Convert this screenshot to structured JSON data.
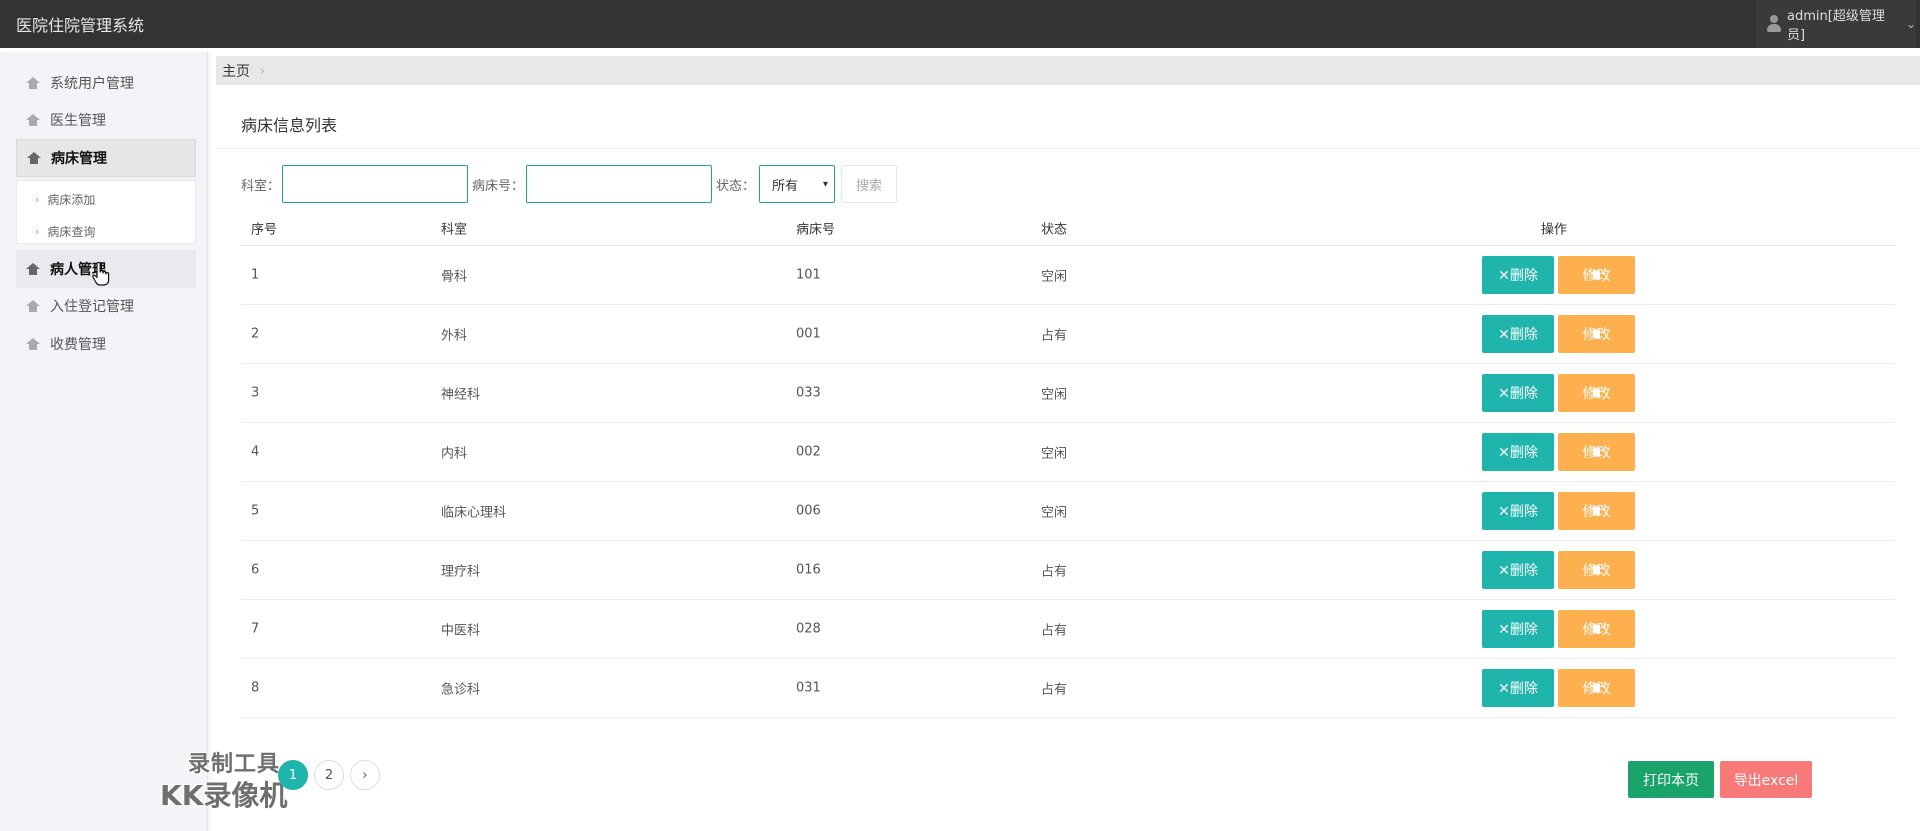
{
  "header": {
    "app_title": "医院住院管理系统",
    "user_label": "admin[超级管理员]"
  },
  "sidebar": {
    "items": [
      {
        "label": "系统用户管理"
      },
      {
        "label": "医生管理"
      },
      {
        "label": "病床管理"
      },
      {
        "label": "病人管理"
      },
      {
        "label": "入住登记管理"
      },
      {
        "label": "收费管理"
      }
    ],
    "submenu": [
      {
        "label": "病床添加"
      },
      {
        "label": "病床查询"
      }
    ]
  },
  "breadcrumb": {
    "home": "主页"
  },
  "panel": {
    "title": "病床信息列表"
  },
  "search": {
    "dept_label": "科室：",
    "bed_label": "病床号：",
    "status_label": "状态：",
    "status_selected": "所有",
    "search_button": "搜索"
  },
  "table": {
    "headers": [
      "序号",
      "科室",
      "病床号",
      "状态",
      "操作"
    ],
    "rows": [
      {
        "no": "1",
        "dept": "骨科",
        "bed": "101",
        "status": "空闲"
      },
      {
        "no": "2",
        "dept": "外科",
        "bed": "001",
        "status": "占有"
      },
      {
        "no": "3",
        "dept": "神经科",
        "bed": "033",
        "status": "空闲"
      },
      {
        "no": "4",
        "dept": "内科",
        "bed": "002",
        "status": "空闲"
      },
      {
        "no": "5",
        "dept": "临床心理科",
        "bed": "006",
        "status": "空闲"
      },
      {
        "no": "6",
        "dept": "理疗科",
        "bed": "016",
        "status": "占有"
      },
      {
        "no": "7",
        "dept": "中医科",
        "bed": "028",
        "status": "占有"
      },
      {
        "no": "8",
        "dept": "急诊科",
        "bed": "031",
        "status": "占有"
      }
    ],
    "delete_label": "✕删除",
    "edit_label": "修改"
  },
  "pagination": {
    "pages": [
      "1",
      "2"
    ],
    "next": "›"
  },
  "watermark": {
    "line1": "录制工具",
    "line2": "KK录像机"
  },
  "actions": {
    "print": "打印本页",
    "export": "导出excel"
  },
  "colors": {
    "accent": "#1fb5ac",
    "edit": "#ffb04e",
    "print": "#1aa36a",
    "export": "#f77a78",
    "topbar": "#333333"
  }
}
